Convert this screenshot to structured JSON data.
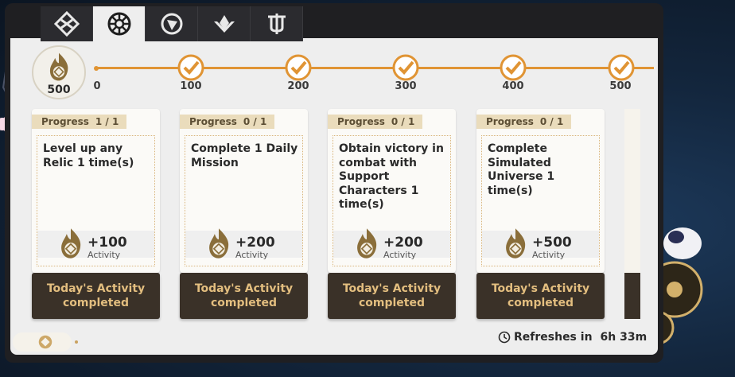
{
  "tabs": [
    {
      "icon": "diamond-emblem-icon",
      "active": false
    },
    {
      "icon": "daily-training-icon",
      "active": true
    },
    {
      "icon": "compass-icon",
      "active": false
    },
    {
      "icon": "lotus-emblem-icon",
      "active": false
    },
    {
      "icon": "trident-emblem-icon",
      "active": false
    }
  ],
  "activity": {
    "current": "500",
    "milestones": [
      "0",
      "100",
      "200",
      "300",
      "400",
      "500"
    ],
    "accent_color": "#e09434"
  },
  "missions": [
    {
      "progress_label": "Progress",
      "progress": "1 / 1",
      "title": "Level up any Relic 1 time(s)",
      "reward": "+100",
      "reward_label": "Activity",
      "status": "Today's Activity completed"
    },
    {
      "progress_label": "Progress",
      "progress": "0 / 1",
      "title": "Complete 1 Daily Mission",
      "reward": "+200",
      "reward_label": "Activity",
      "status": "Today's Activity completed"
    },
    {
      "progress_label": "Progress",
      "progress": "0 / 1",
      "title": "Obtain victory in combat with Support Characters 1 time(s)",
      "reward": "+200",
      "reward_label": "Activity",
      "status": "Today's Activity completed"
    },
    {
      "progress_label": "Progress",
      "progress": "0 / 1",
      "title": "Complete Simulated Universe 1 time(s)",
      "reward": "+500",
      "reward_label": "Activity",
      "status": "Today's Activity completed"
    }
  ],
  "refresh": {
    "label": "Refreshes in",
    "time": "6h 33m",
    "icon": "clock-icon"
  },
  "colors": {
    "button_bg": "#3a3128",
    "button_text": "#e3be7f",
    "tag_bg": "#eadcbc"
  }
}
